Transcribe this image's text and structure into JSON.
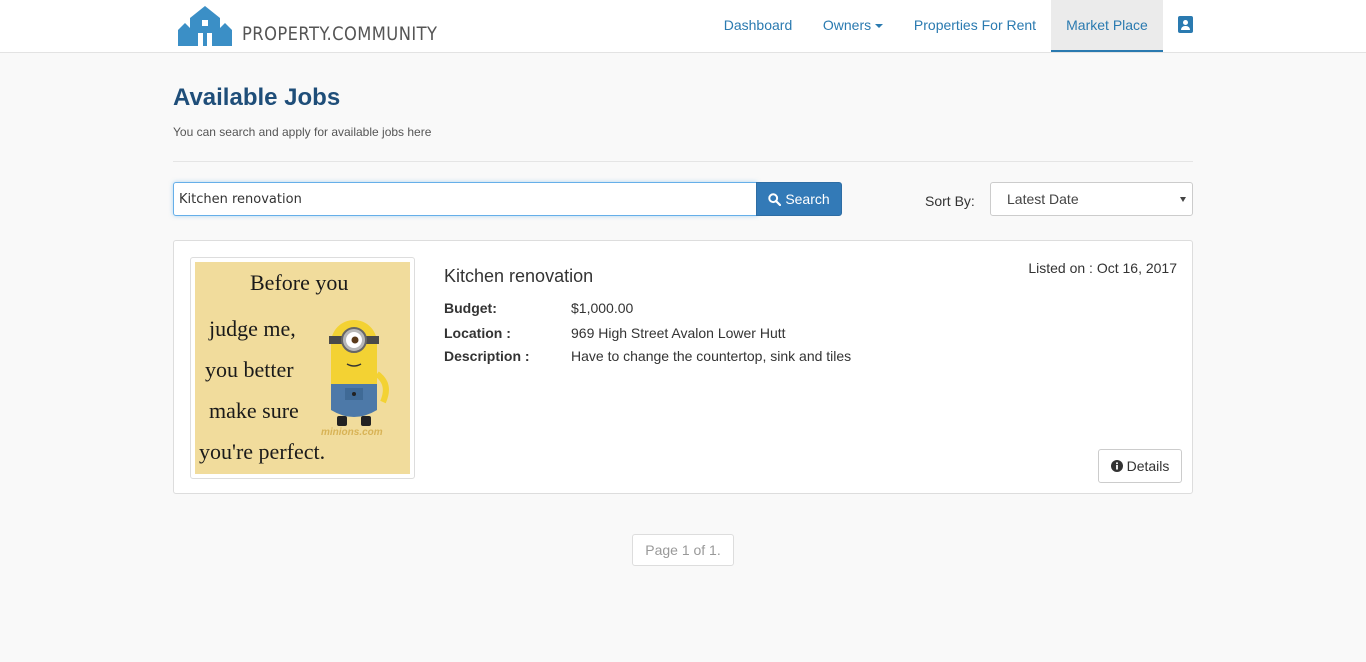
{
  "brand": {
    "name": "PROPERTY.COMMUNITY",
    "logo_icon": "house-icon",
    "accent_color": "#2a7ab0"
  },
  "nav": {
    "items": [
      {
        "label": "Dashboard",
        "active": false
      },
      {
        "label": "Owners",
        "active": false,
        "dropdown": true
      },
      {
        "label": "Properties For Rent",
        "active": false
      },
      {
        "label": "Market Place",
        "active": true
      }
    ],
    "user_icon": "user-profile-icon"
  },
  "page": {
    "title": "Available Jobs",
    "subtitle": "You can search and apply for available jobs here"
  },
  "search": {
    "value": "Kitchen renovation",
    "button_label": "Search",
    "button_icon": "search-icon"
  },
  "sort": {
    "label": "Sort By:",
    "selected": "Latest Date"
  },
  "jobs": [
    {
      "title": "Kitchen renovation",
      "listed_on": "Listed on : Oct 16, 2017",
      "budget_label": "Budget:",
      "budget": "$1,000.00",
      "location_label": "Location :",
      "location": "969 High Street Avalon Lower Hutt",
      "description_label": "Description :",
      "description": "Have to change the countertop, sink and tiles",
      "image": {
        "lines": [
          "Before you",
          "judge me,",
          "you better",
          "make sure",
          "you're perfect."
        ],
        "watermark": "minions.com"
      },
      "details_label": "Details",
      "details_icon": "info-icon"
    }
  ],
  "pagination": {
    "text": "Page 1 of 1."
  }
}
